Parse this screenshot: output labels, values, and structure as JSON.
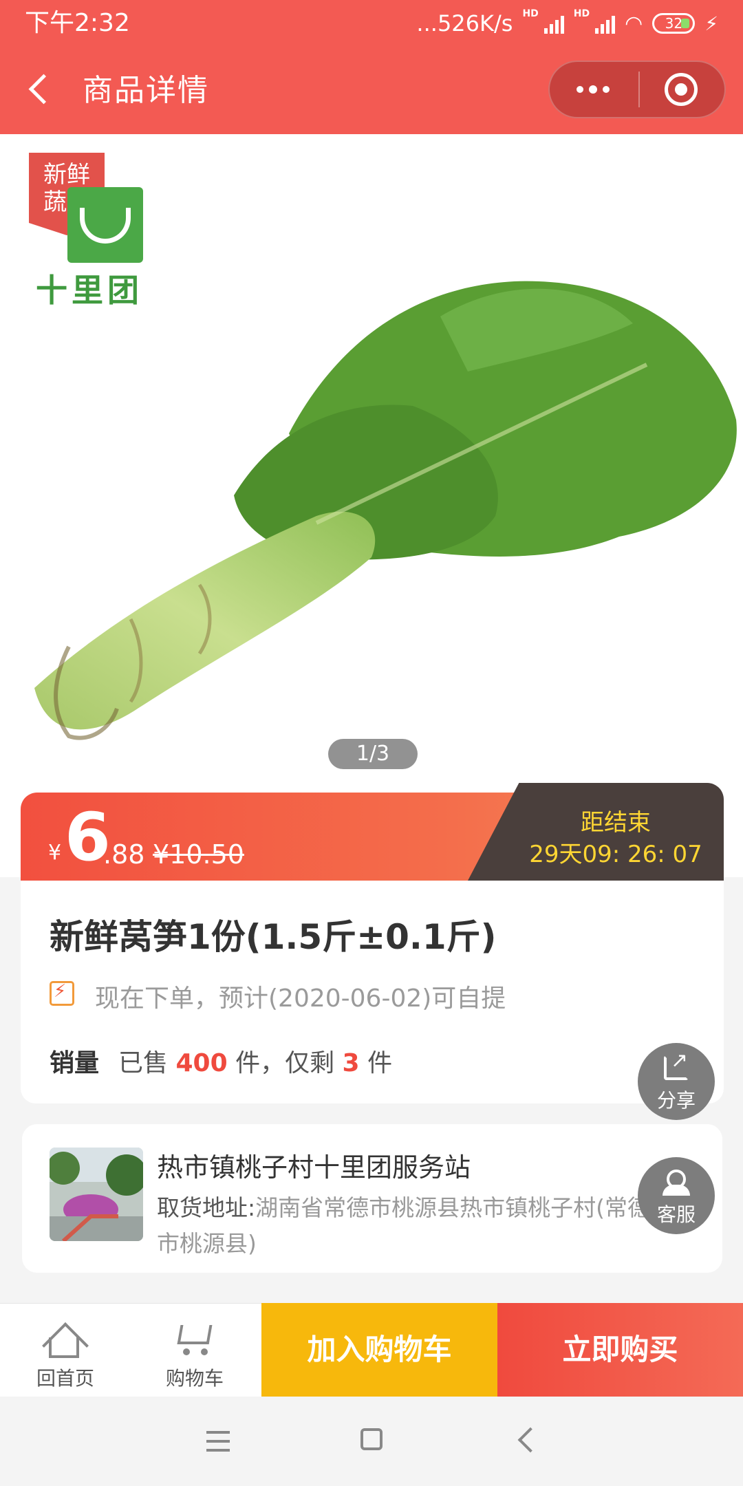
{
  "status_bar": {
    "time": "下午2:32",
    "network_speed": "...526K/s",
    "battery": "32"
  },
  "header": {
    "title": "商品详情",
    "icons": [
      "back-arrow-icon",
      "more-dots-icon",
      "target-circle-icon"
    ]
  },
  "gallery": {
    "badge_line1": "新鲜",
    "badge_line2": "蔬菜",
    "brand": "十里团",
    "pager": "1/3"
  },
  "price": {
    "currency": "¥",
    "integer": "6",
    "decimal": ".88",
    "original": "¥10.50"
  },
  "countdown": {
    "label": "距结束",
    "time": "29天09: 26: 07"
  },
  "product": {
    "title": "新鲜莴笋1份(1.5斤±0.1斤)",
    "pickup_note": "现在下单，预计(2020-06-02)可自提",
    "sales_label": "销量",
    "sold_prefix": "已售",
    "sold_count": "400",
    "sold_mid": "件，仅剩",
    "remaining": "3",
    "unit": "件"
  },
  "fabs": {
    "share": "分享",
    "service": "客服"
  },
  "store": {
    "name": "热市镇桃子村十里团服务站",
    "address_label": "取货地址:",
    "address": "湖南省常德市桃源县热市镇桃子村(常德市桃源县)"
  },
  "bottom_bar": {
    "home": "回首页",
    "cart": "购物车",
    "add_to_cart": "加入购物车",
    "buy_now": "立即购买"
  },
  "colors": {
    "accent_red": "#f35a53",
    "cart_yellow": "#f7b80c",
    "countdown_yellow": "#ffd633"
  }
}
